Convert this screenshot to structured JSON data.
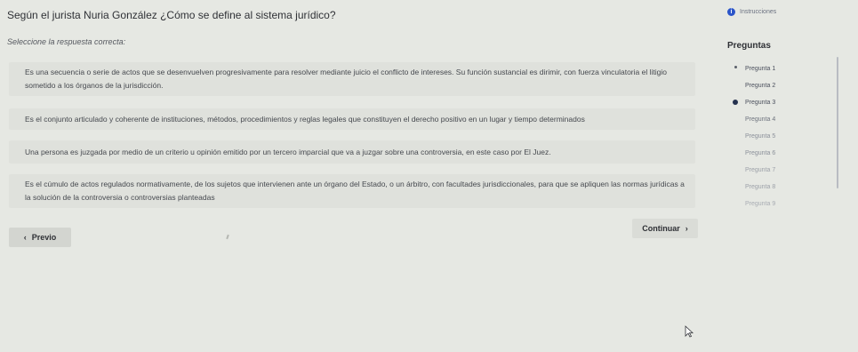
{
  "header": {
    "question": "Según el jurista Nuria González ¿Cómo se define al sistema jurídico?",
    "instructions_label": "Instrucciones"
  },
  "prompt": "Seleccione la respuesta correcta:",
  "options": [
    {
      "text": "Es una secuencia o serie de actos que se desenvuelven progresivamente para resolver mediante juicio el conflicto de intereses. Su función sustancial es dirimir, con fuerza vinculatoria el litigio sometido a los órganos de la jurisdicción."
    },
    {
      "text": "Es el conjunto articulado y coherente de instituciones, métodos, procedimientos y reglas legales que constituyen el derecho positivo en un lugar y tiempo determinados"
    },
    {
      "text": "Una persona es juzgada por medio de un criterio u opinión emitido por un tercero imparcial que va a juzgar sobre una controversia, en este caso por El Juez."
    },
    {
      "text": "Es el cúmulo de actos regulados normativamente, de los sujetos que intervienen ante un órgano del Estado, o un árbitro, con facultades jurisdiccionales, para que se apliquen las normas jurídicas a la solución de la controversia o controversias planteadas"
    }
  ],
  "buttons": {
    "previous": "Previo",
    "continue": "Continuar"
  },
  "nav": {
    "title": "Preguntas",
    "items": [
      {
        "label": "Pregunta 1",
        "state": "answered",
        "color": "#4a4f5c"
      },
      {
        "label": "Pregunta 2",
        "state": "none",
        "color": "#4a4f5c"
      },
      {
        "label": "Pregunta 3",
        "state": "current",
        "color": "#4a4f5c"
      },
      {
        "label": "Pregunta 4",
        "state": "none",
        "color": "#6d727d"
      },
      {
        "label": "Pregunta 5",
        "state": "none",
        "color": "#8a8f99"
      },
      {
        "label": "Pregunta 6",
        "state": "none",
        "color": "#8a8f99"
      },
      {
        "label": "Pregunta 7",
        "state": "none",
        "color": "#9ca0a8"
      },
      {
        "label": "Pregunta 8",
        "state": "none",
        "color": "#9ca0a8"
      },
      {
        "label": "Pregunta 9",
        "state": "none",
        "color": "#a8acb3"
      }
    ]
  },
  "icons": {
    "info": "info-icon",
    "previous": "chevron-left-icon",
    "continue": "chevron-right-icon",
    "cursor": "mouse-cursor-icon"
  },
  "colors": {
    "background": "#e6e8e3",
    "option_background": "#dfe1dc",
    "info_blue": "#2b55c9",
    "current_marker": "#24324f"
  }
}
